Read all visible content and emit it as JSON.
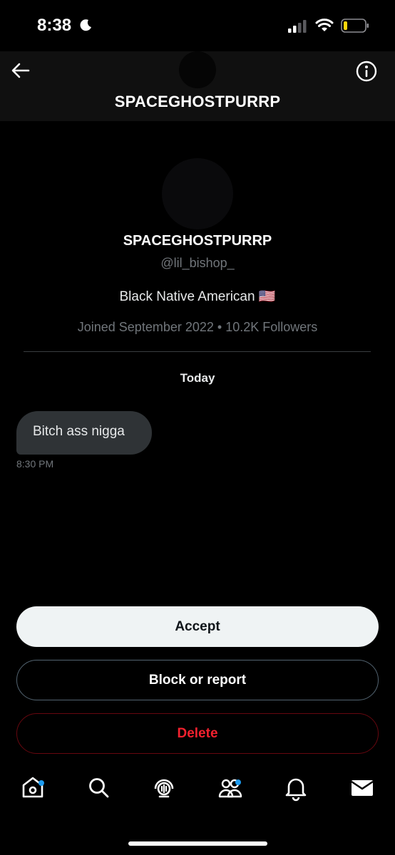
{
  "status_bar": {
    "time": "8:38"
  },
  "header": {
    "title": "SPACEGHOSTPURRP"
  },
  "profile": {
    "name": "SPACEGHOSTPURRP",
    "handle": "@lil_bishop_",
    "bio": "Black Native American 🇺🇸",
    "meta": "Joined September 2022 • 10.2K Followers"
  },
  "conversation": {
    "date_label": "Today",
    "messages": [
      {
        "text": "Bitch ass nigga",
        "time": "8:30 PM"
      }
    ]
  },
  "actions": {
    "accept": "Accept",
    "block_or_report": "Block or report",
    "delete": "Delete"
  },
  "tabs": [
    {
      "icon": "home-icon",
      "badge": true
    },
    {
      "icon": "search-icon",
      "badge": false
    },
    {
      "icon": "spaces-icon",
      "badge": false
    },
    {
      "icon": "communities-icon",
      "badge": true
    },
    {
      "icon": "bell-icon",
      "badge": false
    },
    {
      "icon": "mail-icon",
      "badge": false
    }
  ],
  "colors": {
    "accent": "#1d9bf0",
    "danger": "#f4212e",
    "bubble": "#2f3336",
    "muted_text": "#71767b"
  }
}
